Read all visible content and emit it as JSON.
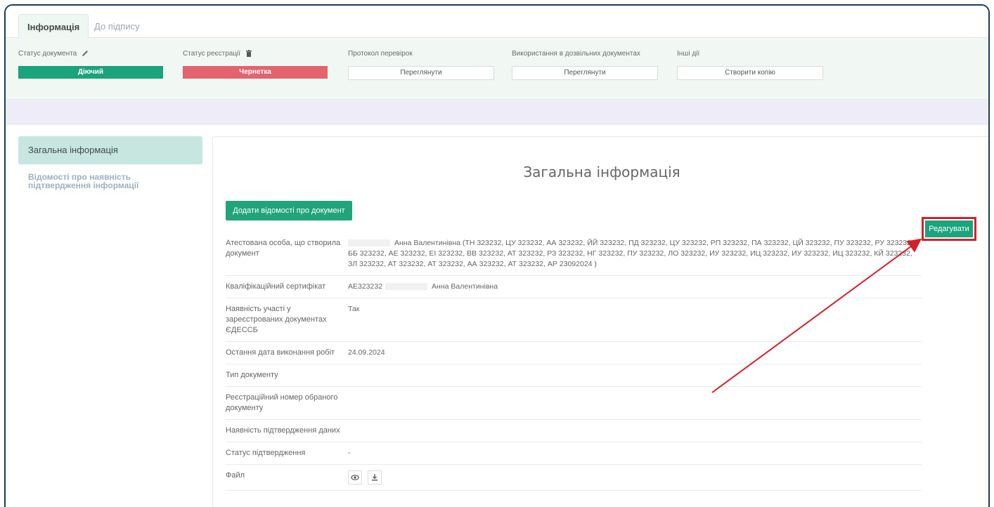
{
  "tabs": [
    {
      "label": "Інформація",
      "active": true
    },
    {
      "label": "До підпису",
      "active": false
    }
  ],
  "status_panel": {
    "document_status": {
      "label": "Статус документа",
      "value": "Діючий"
    },
    "registration_status": {
      "label": "Статус реєстрації",
      "value": "Чернетка"
    },
    "verification_protocol": {
      "label": "Протокол перевірок",
      "button": "Переглянути"
    },
    "permit_usage": {
      "label": "Використання в дозвільних документах",
      "button": "Переглянути"
    },
    "other_actions": {
      "label": "Інші дії",
      "button": "Створити копію"
    }
  },
  "sidebar": {
    "items": [
      {
        "label": "Загальна інформація",
        "active": true
      },
      {
        "label": "Відомості про наявність підтвердження інформації",
        "active": false
      }
    ]
  },
  "main": {
    "title": "Загальна інформація",
    "add_button": "Додати відомості про документ",
    "edit_button": "Редагувати",
    "rows": [
      {
        "label": "Атестована особа, що створила документ",
        "value": "Анна Валентинівна (ТН 323232, ЦУ 323232, АА 323232, ЙЙ 323232, ПД 323232, ЦУ 323232, РП 323232, ПА 323232, ЦЙ 323232, ПУ 323232, РУ 323232, ББ 323232, АЕ 323232, ЕІ 323232, ВВ 323232, АТ 323232, РЗ 323232, НГ 323232, ПУ 323232, ЛО 323232, ИУ 323232, ИЦ 323232, ИУ 323232, ИЦ 323232, КЙ 323232, ЗЛ 323232, АТ 323232, АТ 323232, АА 323232, АТ 323232, АР 23092024 )"
      },
      {
        "label": "Кваліфікаційний сертифікат",
        "value_prefix": "АЕ323232",
        "value": "Анна Валентинівна"
      },
      {
        "label": "Наявність участі у зареєстрованих документах ЄДЕССБ",
        "value": "Так"
      },
      {
        "label": "Остання дата виконання робіт",
        "value": "24.09.2024"
      },
      {
        "label": "Тип документу",
        "value": ""
      },
      {
        "label": "Реєстраційний номер обраного документу",
        "value": ""
      },
      {
        "label": "Наявність підтвердження даних",
        "value": ""
      },
      {
        "label": "Статус підтвердження",
        "value": "-"
      },
      {
        "label": "Файл",
        "value": ""
      }
    ]
  },
  "colors": {
    "accent_green": "#1aa37c",
    "status_red": "#e4636f",
    "annotation_red": "#d4202c",
    "panel_green": "#f1f8f3"
  }
}
